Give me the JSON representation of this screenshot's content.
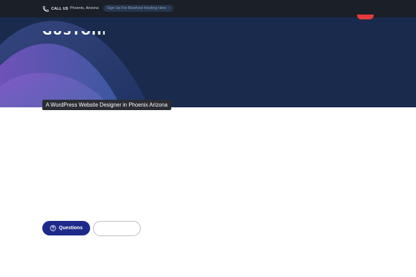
{
  "topbar": {
    "call_label": "CALL US",
    "location": "Phoenix, Arizona",
    "signup_label": "Sign Up For Bluehost Hosting Here",
    "signup_chevron": "›",
    "icons": {
      "phone": "phone-icon",
      "chevron": "chevron-right-icon"
    }
  },
  "hero": {
    "logo_text": "GUSTOHDS",
    "tagline": "A WordPress Website Designer in Phoenix Arizona",
    "colors": {
      "background": "#192a4d",
      "wave_purple": "#7a55c4",
      "accent_red": "#e63a3a"
    }
  },
  "actions": {
    "questions_label": "Questions",
    "secondary_label": "",
    "icons": {
      "questions": "question-circle-icon"
    },
    "colors": {
      "primary": "#1d2a8a"
    }
  }
}
